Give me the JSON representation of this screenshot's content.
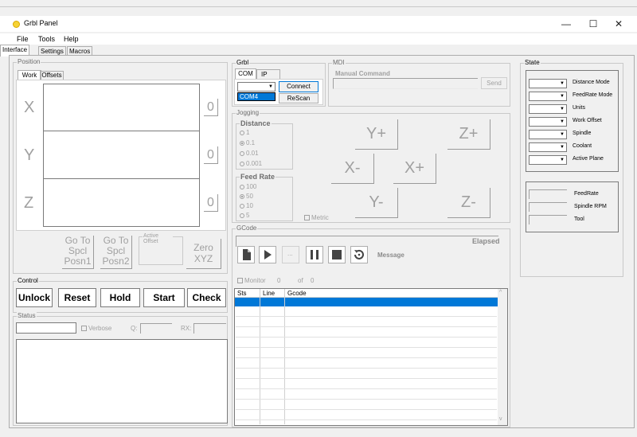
{
  "window": {
    "title": "Grbl Panel",
    "minimize": "—",
    "maximize": "☐",
    "close": "✕"
  },
  "menu": [
    "File",
    "Tools",
    "Help"
  ],
  "tabs": [
    "Interface",
    "Settings",
    "Macros"
  ],
  "position": {
    "label": "Position",
    "tabs": [
      "Work",
      "Offsets"
    ],
    "axes": [
      "X",
      "Y",
      "Z"
    ],
    "zero_labels": [
      "0",
      "0",
      "0"
    ],
    "goto1": [
      "Go To",
      "Spcl",
      "Posn1"
    ],
    "goto2": [
      "Go To",
      "Spcl",
      "Posn2"
    ],
    "active_offset_label": "Active Offset",
    "zero_xyz": [
      "Zero",
      "XYZ"
    ]
  },
  "grbl": {
    "label": "Grbl",
    "tabs": [
      "COM",
      "IP"
    ],
    "port_value": "",
    "port_option": "COM4",
    "connect": "Connect",
    "rescan": "ReScan"
  },
  "mdi": {
    "label": "MDI",
    "manual_command": "Manual Command",
    "send": "Send"
  },
  "jogging": {
    "label": "Jogging",
    "distance_label": "Distance",
    "distances": [
      "1",
      "0.1",
      "0.01",
      "0.001"
    ],
    "distance_selected": "0.1",
    "feed_label": "Feed Rate",
    "feeds": [
      "100",
      "50",
      "10",
      "5"
    ],
    "feed_selected": "50",
    "metric": "Metric",
    "buttons": {
      "yplus": "Y+",
      "zplus": "Z+",
      "xminus": "X-",
      "xplus": "X+",
      "yminus": "Y-",
      "zminus": "Z-"
    }
  },
  "gcode": {
    "label": "GCode",
    "elapsed": "Elapsed",
    "message": "Message",
    "monitor": "Monitor",
    "count": "0",
    "of": "of",
    "total": "0",
    "columns": [
      "Sts",
      "Line",
      "Gcode"
    ],
    "skip": "..."
  },
  "control": {
    "label": "Control",
    "buttons": [
      "Unlock",
      "Reset",
      "Hold",
      "Start",
      "Check"
    ]
  },
  "status": {
    "label": "Status",
    "verbose": "Verbose",
    "q": "Q:",
    "rx": "RX:"
  },
  "state": {
    "label": "State",
    "modes": [
      "Distance Mode",
      "FeedRate Mode",
      "Units",
      "Work Offset",
      "Spindle",
      "Coolant",
      "Active Plane"
    ],
    "readouts": [
      "FeedRate",
      "Spindle RPM",
      "Tool"
    ]
  },
  "colors": {
    "accent": "#0078d7",
    "disabled": "#a0a0a0"
  }
}
